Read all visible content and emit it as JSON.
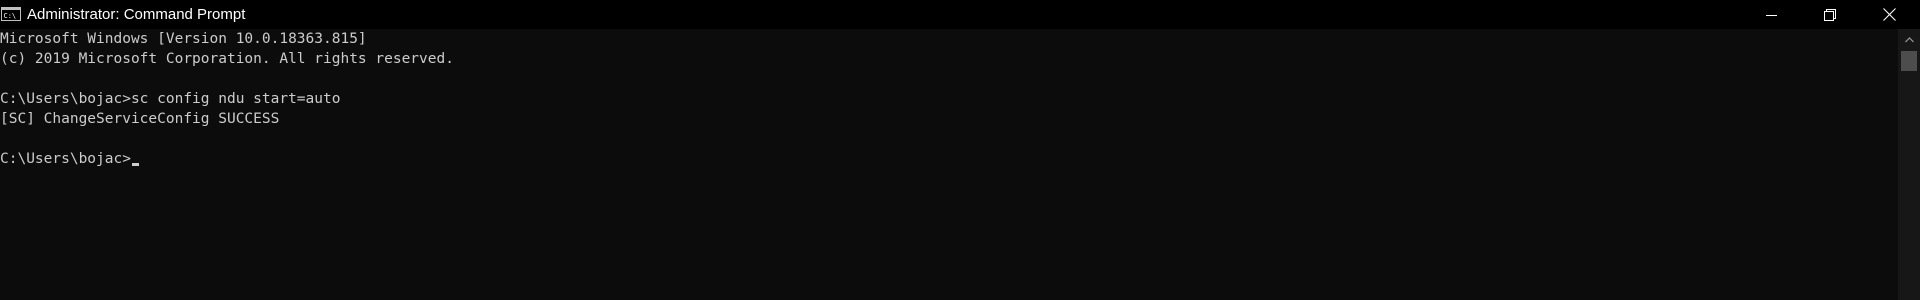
{
  "window": {
    "title": "Administrator: Command Prompt",
    "icons": {
      "app": "cmd-app-icon",
      "minimize": "minimize-icon",
      "restore": "restore-icon",
      "close": "close-icon",
      "scroll_up": "chevron-up-icon"
    }
  },
  "console": {
    "lines": [
      "Microsoft Windows [Version 10.0.18363.815]",
      "(c) 2019 Microsoft Corporation. All rights reserved.",
      "C:\\Users\\bojac>sc config ndu start=auto",
      "[SC] ChangeServiceConfig SUCCESS",
      "C:\\Users\\bojac>"
    ]
  },
  "colors": {
    "titlebar_bg": "#000000",
    "console_bg": "#0c0c0c",
    "text": "#cccccc",
    "title_text": "#ffffff"
  }
}
